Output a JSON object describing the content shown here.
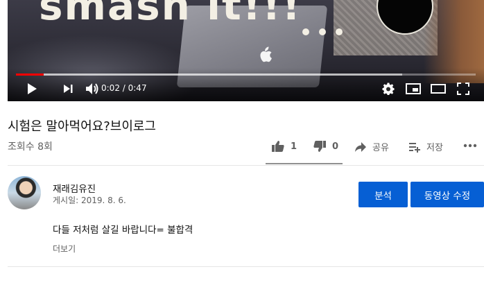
{
  "player": {
    "overlay_text": "smash it!!!",
    "time_current": "0:02",
    "time_separator": " / ",
    "time_total": "0:47",
    "played_fraction": 0.06,
    "buffered_fraction": 0.84
  },
  "video": {
    "title": "시험은 말아먹어요?브이로그",
    "views": "조회수 8회",
    "like_count": "1",
    "dislike_count": "0",
    "share_label": "공유",
    "save_label": "저장"
  },
  "owner": {
    "channel_name": "재래김유진",
    "published": "게시일: 2019. 8. 6.",
    "analytics_button": "분석",
    "edit_video_button": "동영상 수정"
  },
  "description": {
    "text": "다들 저처럼 살길 바랍니다= 불합격",
    "show_more": "더보기"
  },
  "icons": {
    "play": "play-icon",
    "next": "next-icon",
    "volume": "volume-icon",
    "settings": "gear-icon",
    "miniplayer": "miniplayer-icon",
    "theater": "theater-icon",
    "fullscreen": "fullscreen-icon",
    "like": "thumbs-up-icon",
    "dislike": "thumbs-down-icon",
    "share": "share-icon",
    "save": "playlist-add-icon",
    "more": "more-icon"
  },
  "colors": {
    "accent": "#065fd4",
    "progress": "#ff0000"
  }
}
